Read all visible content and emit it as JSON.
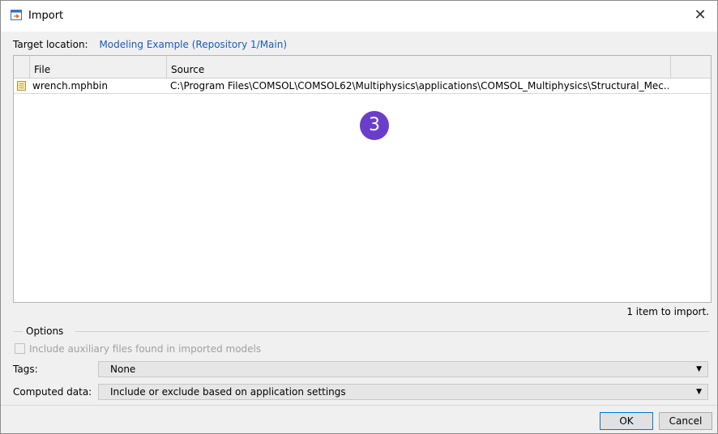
{
  "window": {
    "title": "Import",
    "title_icon": "import-icon",
    "close_icon": "close-icon",
    "close_glyph": "✕"
  },
  "target": {
    "label": "Target location:",
    "value": "Modeling Example (Repository 1/Main)",
    "link_color": "#1a5bbf"
  },
  "table": {
    "columns": [
      "File",
      "Source"
    ],
    "rows": [
      {
        "icon": "file-icon",
        "file": "wrench.mphbin",
        "source": "C:\\Program Files\\COMSOL\\COMSOL62\\Multiphysics\\applications\\COMSOL_Multiphysics\\Structural_Mec..."
      }
    ]
  },
  "step_badge": {
    "number": "3",
    "color": "#6a3ec9"
  },
  "status": {
    "count_text": "1 item to import."
  },
  "options": {
    "legend": "Options",
    "include_aux_label": "Include auxiliary files found in imported models",
    "include_aux_checked": false,
    "include_aux_enabled": false
  },
  "fields": {
    "tags_label": "Tags:",
    "tags_value": "None",
    "computed_label": "Computed data:",
    "computed_value": "Include or exclude based on application settings",
    "dropdown_glyph": "▼"
  },
  "buttons": {
    "ok": "OK",
    "cancel": "Cancel"
  }
}
